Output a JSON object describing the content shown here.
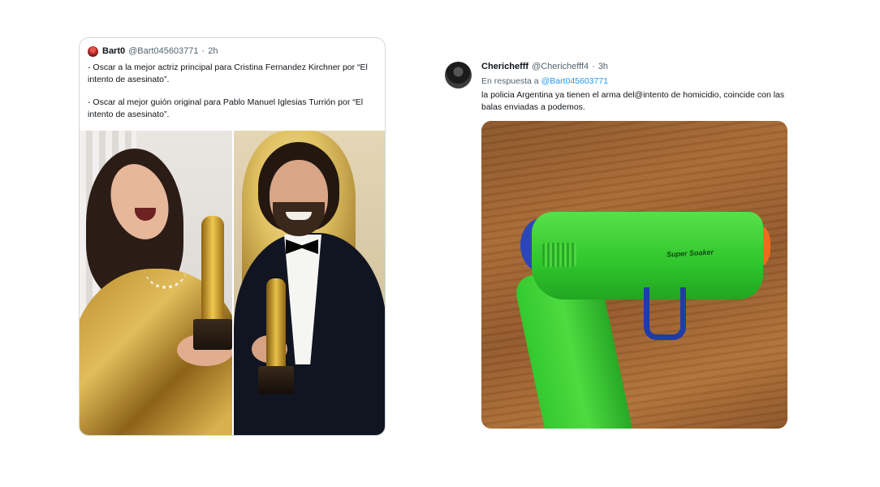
{
  "left_tweet": {
    "display_name": "Bart0",
    "handle": "@Bart045603771",
    "separator": "·",
    "time": "2h",
    "paragraphs": [
      "- Oscar a la mejor actriz principal para Cristina Fernandez Kirchner por “El intento de asesinato”.",
      "- Oscar al mejor guión original para Pablo Manuel Iglesias Turrión por “El intento de asesinato”."
    ]
  },
  "right_tweet": {
    "display_name": "Cherichefff",
    "handle": "@Cherichefff4",
    "separator": "·",
    "time": "3h",
    "reply_prefix": "En respuesta a",
    "reply_mention": "@Bart045603771",
    "text": "la policia Argentina ya tienen el arma  del@intento de homicidio, coincide con las balas enviadas a podemos.",
    "image_text": "Super Soaker"
  },
  "icons": {
    "left_avatar": "avatar-image",
    "right_avatar": "avatar-image"
  }
}
